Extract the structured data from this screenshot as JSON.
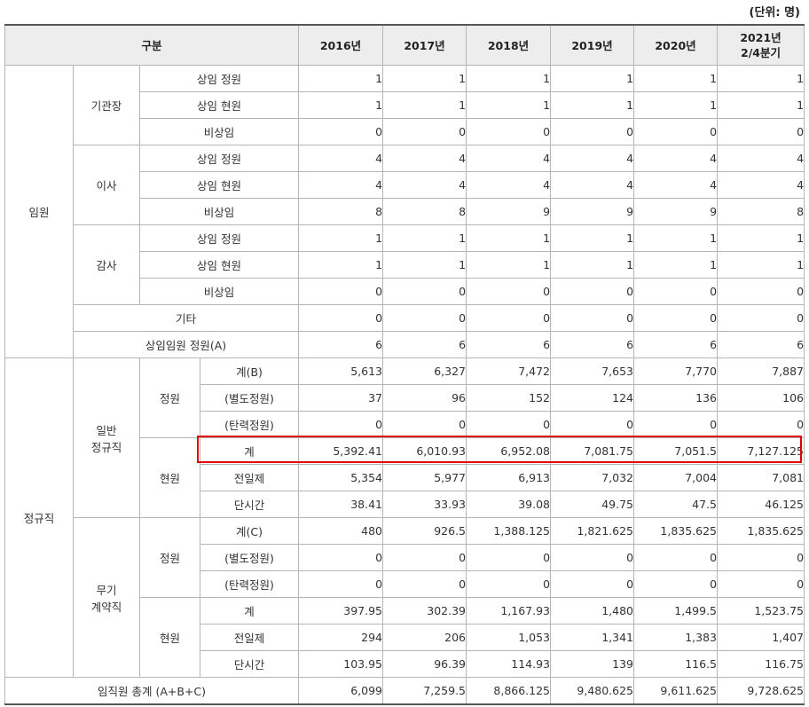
{
  "unit_label": "(단위: 명)",
  "header": {
    "category": "구분",
    "years": [
      "2016년",
      "2017년",
      "2018년",
      "2019년",
      "2020년",
      "2021년\n2/4분기"
    ]
  },
  "executives": {
    "label": "임원",
    "groups": [
      {
        "label": "기관장",
        "rows": [
          {
            "label": "상임 정원",
            "values": [
              "1",
              "1",
              "1",
              "1",
              "1",
              "1"
            ]
          },
          {
            "label": "상임 현원",
            "values": [
              "1",
              "1",
              "1",
              "1",
              "1",
              "1"
            ]
          },
          {
            "label": "비상임",
            "values": [
              "0",
              "0",
              "0",
              "0",
              "0",
              "0"
            ]
          }
        ]
      },
      {
        "label": "이사",
        "rows": [
          {
            "label": "상임 정원",
            "values": [
              "4",
              "4",
              "4",
              "4",
              "4",
              "4"
            ]
          },
          {
            "label": "상임 현원",
            "values": [
              "4",
              "4",
              "4",
              "4",
              "4",
              "4"
            ]
          },
          {
            "label": "비상임",
            "values": [
              "8",
              "8",
              "9",
              "9",
              "9",
              "8"
            ]
          }
        ]
      },
      {
        "label": "감사",
        "rows": [
          {
            "label": "상임 정원",
            "values": [
              "1",
              "1",
              "1",
              "1",
              "1",
              "1"
            ]
          },
          {
            "label": "상임 현원",
            "values": [
              "1",
              "1",
              "1",
              "1",
              "1",
              "1"
            ]
          },
          {
            "label": "비상임",
            "values": [
              "0",
              "0",
              "0",
              "0",
              "0",
              "0"
            ]
          }
        ]
      }
    ],
    "other": {
      "label": "기타",
      "values": [
        "0",
        "0",
        "0",
        "0",
        "0",
        "0"
      ]
    },
    "subtotal": {
      "label": "상임임원 정원(A)",
      "values": [
        "6",
        "6",
        "6",
        "6",
        "6",
        "6"
      ]
    }
  },
  "regular": {
    "label": "정규직",
    "sections": [
      {
        "label": "일반\n정규직",
        "groups": [
          {
            "label": "정원",
            "rows": [
              {
                "label": "계(B)",
                "values": [
                  "5,613",
                  "6,327",
                  "7,472",
                  "7,653",
                  "7,770",
                  "7,887"
                ]
              },
              {
                "label": "(별도정원)",
                "values": [
                  "37",
                  "96",
                  "152",
                  "124",
                  "136",
                  "106"
                ]
              },
              {
                "label": "(탄력정원)",
                "values": [
                  "0",
                  "0",
                  "0",
                  "0",
                  "0",
                  "0"
                ]
              }
            ]
          },
          {
            "label": "현원",
            "rows": [
              {
                "label": "계",
                "values": [
                  "5,392.41",
                  "6,010.93",
                  "6,952.08",
                  "7,081.75",
                  "7,051.5",
                  "7,127.125"
                ]
              },
              {
                "label": "전일제",
                "values": [
                  "5,354",
                  "5,977",
                  "6,913",
                  "7,032",
                  "7,004",
                  "7,081"
                ]
              },
              {
                "label": "단시간",
                "values": [
                  "38.41",
                  "33.93",
                  "39.08",
                  "49.75",
                  "47.5",
                  "46.125"
                ]
              }
            ]
          }
        ]
      },
      {
        "label": "무기\n계약직",
        "groups": [
          {
            "label": "정원",
            "rows": [
              {
                "label": "계(C)",
                "values": [
                  "480",
                  "926.5",
                  "1,388.125",
                  "1,821.625",
                  "1,835.625",
                  "1,835.625"
                ]
              },
              {
                "label": "(별도정원)",
                "values": [
                  "0",
                  "0",
                  "0",
                  "0",
                  "0",
                  "0"
                ]
              },
              {
                "label": "(탄력정원)",
                "values": [
                  "0",
                  "0",
                  "0",
                  "0",
                  "0",
                  "0"
                ]
              }
            ]
          },
          {
            "label": "현원",
            "rows": [
              {
                "label": "계",
                "values": [
                  "397.95",
                  "302.39",
                  "1,167.93",
                  "1,480",
                  "1,499.5",
                  "1,523.75"
                ]
              },
              {
                "label": "전일제",
                "values": [
                  "294",
                  "206",
                  "1,053",
                  "1,341",
                  "1,383",
                  "1,407"
                ]
              },
              {
                "label": "단시간",
                "values": [
                  "103.95",
                  "96.39",
                  "114.93",
                  "139",
                  "116.5",
                  "116.75"
                ]
              }
            ]
          }
        ]
      }
    ]
  },
  "total": {
    "label": "임직원 총계 (A+B+C)",
    "values": [
      "6,099",
      "7,259.5",
      "8,866.125",
      "9,480.625",
      "9,611.625",
      "9,728.625"
    ]
  },
  "highlight_color": "#e00000"
}
